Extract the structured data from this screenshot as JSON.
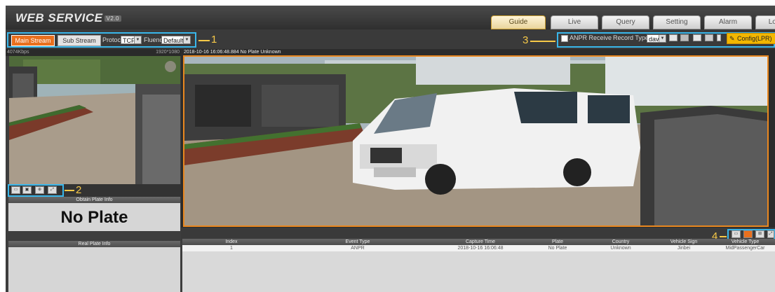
{
  "header": {
    "logo": "WEB SERVICE",
    "version": "V2.0",
    "tabs": [
      {
        "label": "Guide",
        "active": true
      },
      {
        "label": "Live",
        "active": false
      },
      {
        "label": "Query",
        "active": false
      },
      {
        "label": "Setting",
        "active": false
      },
      {
        "label": "Alarm",
        "active": false
      },
      {
        "label": "Logout",
        "active": false
      }
    ]
  },
  "toolbar": {
    "main_stream": "Main Stream",
    "sub_stream": "Sub Stream",
    "protocol_label": "Protocol",
    "protocol_value": "TCP",
    "fluency_label": "Fluency",
    "fluency_value": "Default",
    "anpr_receive": "ANPR Receive",
    "record_type_label": "Record Type",
    "record_type_value": "dav",
    "config_button": "Config(LPR)"
  },
  "callouts": {
    "c1": "1",
    "c2": "2",
    "c3": "3",
    "c4": "4"
  },
  "left_panel": {
    "bitrate": "4074Kbps",
    "resolution": "1920*1080",
    "obtain_plate_title": "Obtain Plate Info",
    "plate_value": "No Plate",
    "real_plate_title": "Real Plate Info"
  },
  "video": {
    "osd": "2018-10-16 16:06:48.884 No Plate Unknown"
  },
  "table": {
    "headers": [
      "Index",
      "Event Type",
      "Capture Time",
      "Plate",
      "Country",
      "Vehicle Sign",
      "Vehicle Type"
    ],
    "rows": [
      [
        "1",
        "ANPR",
        "2018-10-16 16:06:48",
        "No Plate",
        "Unknown",
        "Jinbei",
        "MidPassengerCar"
      ]
    ]
  },
  "colors": {
    "accent": "#e9701e",
    "highlight": "#39b6ea",
    "callout": "#f7c948"
  }
}
